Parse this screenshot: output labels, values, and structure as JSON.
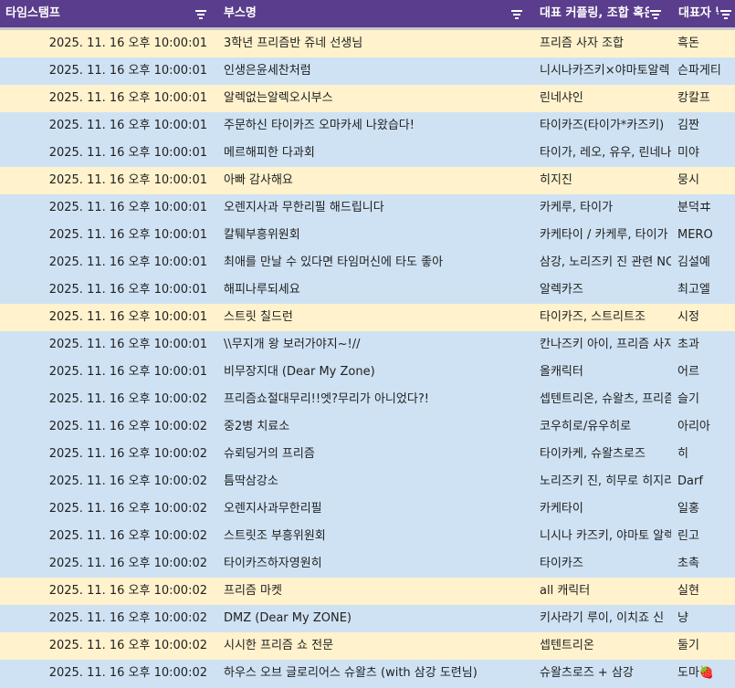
{
  "header": {
    "columns": [
      {
        "label": "타임스탬프"
      },
      {
        "label": "부스명"
      },
      {
        "label": "대표 커플링, 조합 혹은 캐릭터"
      },
      {
        "label": "대표자 닉네임"
      }
    ]
  },
  "rows": [
    {
      "timestamp": "2025. 11. 16 오후 10:00:01",
      "booth": "3학년 프리즘반 쥬네 선생님",
      "coupling": "프리즘 사자 조합",
      "rep": "흑돈",
      "color": "yellow"
    },
    {
      "timestamp": "2025. 11. 16 오후 10:00:01",
      "booth": "인생은윤세찬처럼",
      "coupling": "니시나카즈키×야마토알렉",
      "rep": "슨파게티",
      "color": "blue"
    },
    {
      "timestamp": "2025. 11. 16 오후 10:00:01",
      "booth": "알렉없는알렉오시부스",
      "coupling": "린네샤인",
      "rep": "캉칼프",
      "color": "yellow"
    },
    {
      "timestamp": "2025. 11. 16 오후 10:00:01",
      "booth": "주문하신 타이카즈 오마카세 나왔습다!",
      "coupling": "타이카즈(타이가*카즈키)",
      "rep": "김짠",
      "color": "blue"
    },
    {
      "timestamp": "2025. 11. 16 오후 10:00:01",
      "booth": "메르해피한 다과회",
      "coupling": "타이가, 레오, 유우, 린네나",
      "rep": "미야",
      "color": "blue"
    },
    {
      "timestamp": "2025. 11. 16 오후 10:00:01",
      "booth": "아빠 감사해요",
      "coupling": "히지진",
      "rep": "뭉시",
      "color": "yellow"
    },
    {
      "timestamp": "2025. 11. 16 오후 10:00:01",
      "booth": "오렌지사과 무한리필 해드립니다",
      "coupling": "카케루, 타이가",
      "rep": "분덕ヰ",
      "color": "blue"
    },
    {
      "timestamp": "2025. 11. 16 오후 10:00:01",
      "booth": "칼퉤부흥위원회",
      "coupling": "카케타이 / 카케루, 타이가",
      "rep": "MERO",
      "color": "blue"
    },
    {
      "timestamp": "2025. 11. 16 오후 10:00:01",
      "booth": "최애를 만날 수 있다면 타임머신에 타도 좋아",
      "coupling": "삼강, 노리즈키 진 관련 NC",
      "rep": "김설예",
      "color": "blue"
    },
    {
      "timestamp": "2025. 11. 16 오후 10:00:01",
      "booth": "해피나루되세요",
      "coupling": "알렉카즈",
      "rep": "최고엘",
      "color": "blue"
    },
    {
      "timestamp": "2025. 11. 16 오후 10:00:01",
      "booth": "스트릿 칠드런",
      "coupling": "타이카즈, 스트리트조",
      "rep": "시정",
      "color": "yellow"
    },
    {
      "timestamp": "2025. 11. 16 오후 10:00:01",
      "booth": "\\\\무지개 왕 보러가야지~!//",
      "coupling": "칸나즈키 아이, 프리즘 사자",
      "rep": "초과",
      "color": "blue"
    },
    {
      "timestamp": "2025. 11. 16 오후 10:00:01",
      "booth": "비무장지대 (Dear My Zone)",
      "coupling": "올캐릭터",
      "rep": "어르",
      "color": "blue"
    },
    {
      "timestamp": "2025. 11. 16 오후 10:00:02",
      "booth": "프리즘쇼절대무리!!엣?무리가 아니었다?!",
      "coupling": "셉텐트리온, 슈왈츠, 프리즘",
      "rep": "슬기",
      "color": "blue"
    },
    {
      "timestamp": "2025. 11. 16 오후 10:00:02",
      "booth": "중2병 치료소",
      "coupling": "코우히로/유우히로",
      "rep": "아리아",
      "color": "blue"
    },
    {
      "timestamp": "2025. 11. 16 오후 10:00:02",
      "booth": "슈뢰딩거의 프리즘",
      "coupling": "타이카케, 슈왈츠로즈",
      "rep": "히",
      "color": "blue"
    },
    {
      "timestamp": "2025. 11. 16 오후 10:00:02",
      "booth": "틈딱삼강소",
      "coupling": "노리즈키 진, 히무로 히지리",
      "rep": "Darf",
      "color": "blue"
    },
    {
      "timestamp": "2025. 11. 16 오후 10:00:02",
      "booth": "오렌지사과무한리필",
      "coupling": "카케타이",
      "rep": "일홍",
      "color": "blue"
    },
    {
      "timestamp": "2025. 11. 16 오후 10:00:02",
      "booth": "스트릿조 부흥위원회",
      "coupling": "니시나 카즈키, 야마토 알렉",
      "rep": "린고",
      "color": "blue"
    },
    {
      "timestamp": "2025. 11. 16 오후 10:00:02",
      "booth": "타이카즈하자영원히",
      "coupling": "타이카즈",
      "rep": "초촉",
      "color": "blue"
    },
    {
      "timestamp": "2025. 11. 16 오후 10:00:02",
      "booth": "프리즘 마켓",
      "coupling": "all 캐릭터",
      "rep": "실현",
      "color": "yellow"
    },
    {
      "timestamp": "2025. 11. 16 오후 10:00:02",
      "booth": "DMZ (Dear My ZONE)",
      "coupling": "키사라기 루이, 이치죠 신",
      "rep": "냥",
      "color": "blue"
    },
    {
      "timestamp": "2025. 11. 16 오후 10:00:02",
      "booth": "시시한 프리즘 쇼 전문",
      "coupling": " 셉텐트리온",
      "rep": "둘기",
      "color": "yellow"
    },
    {
      "timestamp": "2025. 11. 16 오후 10:00:02",
      "booth": "하우스 오브 글로리어스 슈왈츠 (with 삼강 도련님)",
      "coupling": "슈왈츠로즈 + 삼강",
      "rep": "도마🍓",
      "color": "blue"
    }
  ]
}
